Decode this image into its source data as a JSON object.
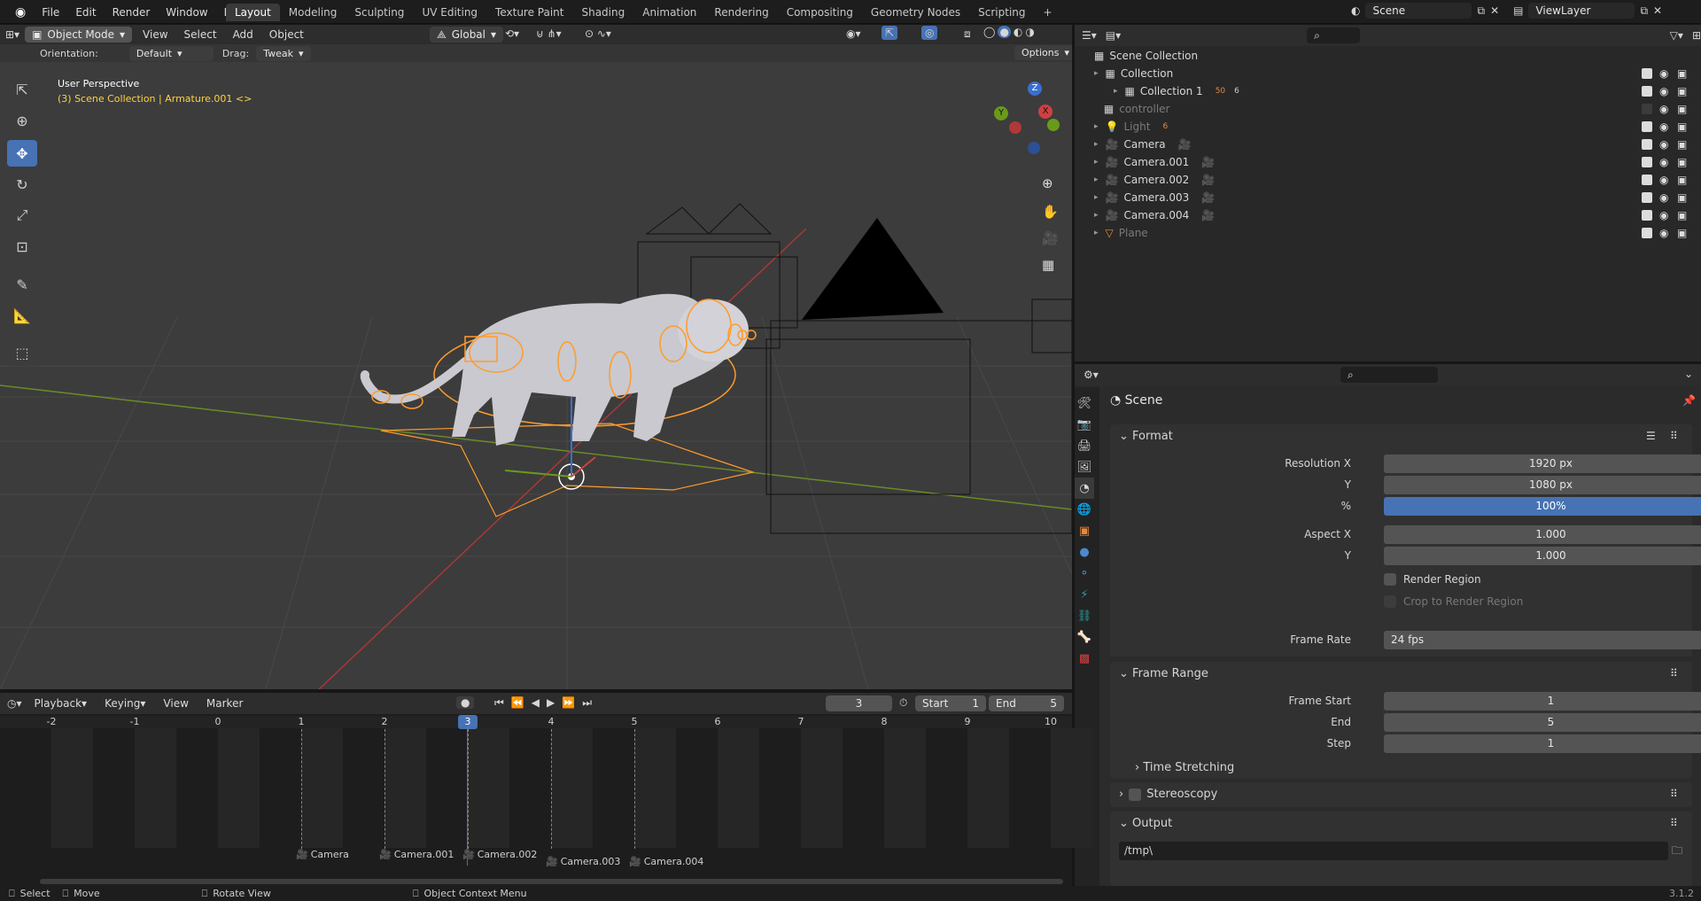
{
  "topbar": {
    "menus": [
      "File",
      "Edit",
      "Render",
      "Window",
      "Help"
    ],
    "tabs": [
      "Layout",
      "Modeling",
      "Sculpting",
      "UV Editing",
      "Texture Paint",
      "Shading",
      "Animation",
      "Rendering",
      "Compositing",
      "Geometry Nodes",
      "Scripting"
    ],
    "active_tab": "Layout",
    "add_tab": "+",
    "scene": "Scene",
    "view_layer": "ViewLayer"
  },
  "viewport": {
    "mode": "Object Mode",
    "menus": [
      "View",
      "Select",
      "Add",
      "Object"
    ],
    "transform": "Global",
    "orientation_label": "Orientation:",
    "orientation": "Default",
    "drag_label": "Drag:",
    "drag": "Tweak",
    "options": "Options",
    "perspective": "User Perspective",
    "context": "(3) Scene Collection | Armature.001 <>",
    "gizmo": {
      "z": "Z",
      "y": "Y",
      "x": "X"
    }
  },
  "outliner": {
    "root": "Scene Collection",
    "items": [
      {
        "name": "Collection",
        "indent": 1
      },
      {
        "name": "Collection 1",
        "indent": 2,
        "badge1": "50",
        "badge2": "6"
      },
      {
        "name": "controller",
        "indent": 1,
        "dim": true
      },
      {
        "name": "Light",
        "indent": 1,
        "dim": true,
        "badge1": "6"
      },
      {
        "name": "Camera",
        "indent": 1
      },
      {
        "name": "Camera.001",
        "indent": 1
      },
      {
        "name": "Camera.002",
        "indent": 1
      },
      {
        "name": "Camera.003",
        "indent": 1
      },
      {
        "name": "Camera.004",
        "indent": 1
      },
      {
        "name": "Plane",
        "indent": 1,
        "dim": true
      }
    ]
  },
  "properties": {
    "title": "Scene",
    "format": {
      "header": "Format",
      "res_x_label": "Resolution X",
      "res_x": "1920 px",
      "res_y_label": "Y",
      "res_y": "1080 px",
      "pct_label": "%",
      "pct": "100%",
      "aspect_x_label": "Aspect X",
      "aspect_x": "1.000",
      "aspect_y_label": "Y",
      "aspect_y": "1.000",
      "render_region": "Render Region",
      "crop": "Crop to Render Region",
      "frame_rate_label": "Frame Rate",
      "frame_rate": "24 fps"
    },
    "frame_range": {
      "header": "Frame Range",
      "start_label": "Frame Start",
      "start": "1",
      "end_label": "End",
      "end": "5",
      "step_label": "Step",
      "step": "1",
      "time_stretching": "Time Stretching"
    },
    "stereoscopy": "Stereoscopy",
    "output": {
      "header": "Output",
      "path": "/tmp\\"
    }
  },
  "timeline": {
    "menus": [
      "Playback",
      "Keying",
      "View",
      "Marker"
    ],
    "current": "3",
    "start_label": "Start",
    "start": "1",
    "end_label": "End",
    "end": "5",
    "ticks": [
      "-2",
      "-1",
      "0",
      "1",
      "2",
      "3",
      "4",
      "5",
      "6",
      "7",
      "8",
      "9",
      "10"
    ],
    "markers": [
      "Camera",
      "Camera.001",
      "Camera.002",
      "Camera.003",
      "Camera.004"
    ]
  },
  "status": {
    "select": "Select",
    "move": "Move",
    "rotate": "Rotate View",
    "context_menu": "Object Context Menu",
    "version": "3.1.2"
  },
  "colors": {
    "accent": "#4772b3",
    "selection": "#ff9b2b",
    "camera_icon": "#e8893a"
  }
}
